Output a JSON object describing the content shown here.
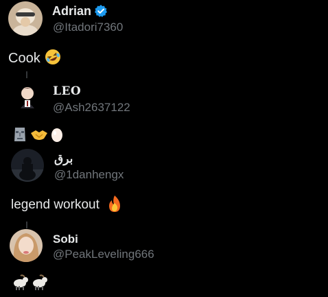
{
  "posts": [
    {
      "display_name": "Adrian",
      "handle": "@Itadori7360",
      "verified": true,
      "text": "Cook",
      "emoji": [
        "rolling-on-floor-laughing"
      ]
    },
    {
      "display_name": "LEO",
      "handle": "@Ash2637122",
      "text": "",
      "emoji": [
        "moai",
        "handshake",
        "egg"
      ]
    },
    {
      "display_name": "برق",
      "handle": "@1danhengx",
      "text": "legend workout",
      "emoji": [
        "fire"
      ]
    },
    {
      "display_name": "Sobi",
      "handle": "@PeakLeveling666",
      "text": "",
      "emoji": [
        "goat",
        "goat"
      ]
    }
  ],
  "colors": {
    "background": "#000000",
    "primary_text": "#e7e9ea",
    "secondary_text": "#71767b",
    "verified_badge": "#1d9bf0",
    "thread_line": "#333639"
  }
}
